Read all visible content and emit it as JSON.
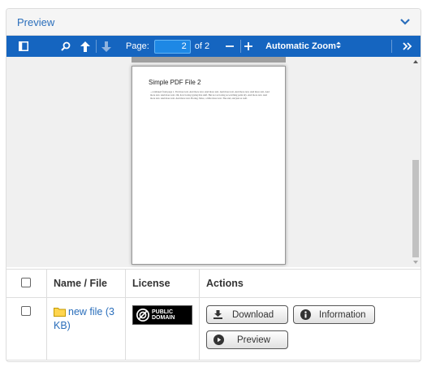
{
  "panel": {
    "title": "Preview"
  },
  "toolbar": {
    "page_label": "Page:",
    "page_value": "2",
    "page_of": "of 2",
    "zoom_value": "Automatic Zoom",
    "accent": "#1565c0"
  },
  "pdf": {
    "page_title": "Simple PDF File 2",
    "page_text": "...continued from page 1. Yet more text. And more text. And more text. And more text. And more text. And more text. And more text. And more text. Oh, how boring typing this stuff. But not as boring as watching paint dry. And more text. And more text. And more text. And more text. Boring. More, a little more text. The end, and just as well."
  },
  "table": {
    "headers": {
      "name": "Name / File",
      "license": "License",
      "actions": "Actions"
    },
    "rows": [
      {
        "name": "new file (3 KB)",
        "license_line1": "PUBLIC",
        "license_line2": "DOMAIN",
        "actions": {
          "download": "Download",
          "information": "Information",
          "preview": "Preview"
        }
      }
    ]
  }
}
